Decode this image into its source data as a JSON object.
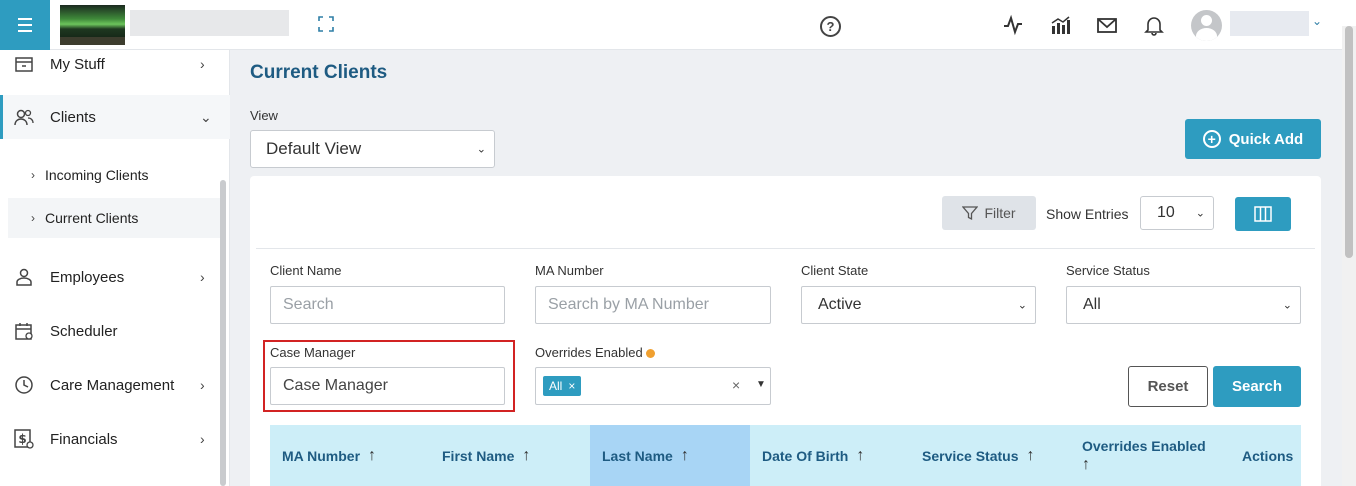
{
  "header": {
    "help_icon": "?",
    "icons": [
      "activity-icon",
      "chart-icon",
      "mail-icon",
      "bell-icon"
    ]
  },
  "sidebar": {
    "items": [
      {
        "label": "My Stuff",
        "icon": "archive-icon",
        "chevron": "›"
      },
      {
        "label": "Clients",
        "icon": "users-icon",
        "chevron": "⌄"
      },
      {
        "label": "Employees",
        "icon": "employee-icon",
        "chevron": "›"
      },
      {
        "label": "Scheduler",
        "icon": "calendar-icon",
        "chevron": ""
      },
      {
        "label": "Care Management",
        "icon": "clock-icon",
        "chevron": "›"
      },
      {
        "label": "Financials",
        "icon": "dollar-icon",
        "chevron": "›"
      }
    ],
    "sub_items": [
      {
        "label": "Incoming Clients",
        "chevron": "›"
      },
      {
        "label": "Current Clients",
        "chevron": "›"
      }
    ]
  },
  "main": {
    "title": "Current Clients",
    "view_label": "View",
    "view_value": "Default View",
    "quick_add_label": "Quick Add",
    "filter_label": "Filter",
    "show_entries_label": "Show Entries",
    "entries_value": "10",
    "filters": {
      "client_name_label": "Client Name",
      "client_name_placeholder": "Search",
      "ma_number_label": "MA Number",
      "ma_number_placeholder": "Search by MA Number",
      "client_state_label": "Client State",
      "client_state_value": "Active",
      "service_status_label": "Service Status",
      "service_status_value": "All",
      "case_manager_label": "Case Manager",
      "case_manager_value": "Case Manager",
      "overrides_label": "Overrides Enabled",
      "overrides_tag": "All",
      "tag_remove": "×",
      "clear_all": "×"
    },
    "reset_label": "Reset",
    "search_label": "Search",
    "table": {
      "columns": [
        "MA Number",
        "First Name",
        "Last Name",
        "Date Of Birth",
        "Service Status",
        "Overrides Enabled",
        "Actions"
      ],
      "sort_glyph": "↑"
    }
  },
  "colors": {
    "accent": "#2e9cc0",
    "title": "#1e5b82",
    "highlight": "#d22323",
    "header_row": "#cdeef8",
    "sorted_column": "#a8d5f5"
  }
}
